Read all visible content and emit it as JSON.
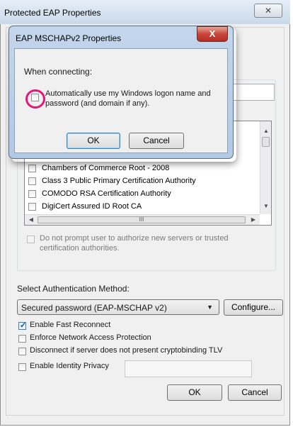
{
  "outer": {
    "title": "Protected EAP Properties",
    "close_glyph": "✕",
    "dont_prompt_label_line1": "Do not prompt user to authorize new servers or trusted",
    "dont_prompt_label_line2": "certification authorities.",
    "auth_method_label": "Select Authentication Method:",
    "auth_method_value": "Secured password (EAP-MSCHAP v2)",
    "configure_button": "Configure...",
    "options": {
      "fast_reconnect": {
        "label": "Enable Fast Reconnect",
        "checked": true
      },
      "nap": {
        "label": "Enforce Network Access Protection",
        "checked": false
      },
      "cryptobinding": {
        "label": "Disconnect if server does not present cryptobinding TLV",
        "checked": false
      },
      "identity_privacy": {
        "label": "Enable Identity Privacy",
        "checked": false
      }
    },
    "identity_privacy_value": "",
    "ok_button": "OK",
    "cancel_button": "Cancel"
  },
  "certificates": [
    {
      "label": "Chambers of Commerce Root - 2008",
      "checked": false
    },
    {
      "label": "Class 3 Public Primary Certification Authority",
      "checked": false
    },
    {
      "label": "COMODO RSA Certification Authority",
      "checked": false
    },
    {
      "label": "DigiCert Assured ID Root CA",
      "checked": false
    }
  ],
  "hscroll_glyph": "III",
  "inner": {
    "title": "EAP MSCHAPv2 Properties",
    "close_glyph": "X",
    "when_connecting_label": "When connecting:",
    "auto_logon_line1": "Automatically use my Windows logon name and",
    "auto_logon_line2": "password (and domain if any).",
    "auto_logon_checked": false,
    "ok_button": "OK",
    "cancel_button": "Cancel"
  },
  "colors": {
    "annotation_circle": "#e0187a",
    "inner_close_red": "#c8453a",
    "window_frame": "#c3d6ec"
  }
}
